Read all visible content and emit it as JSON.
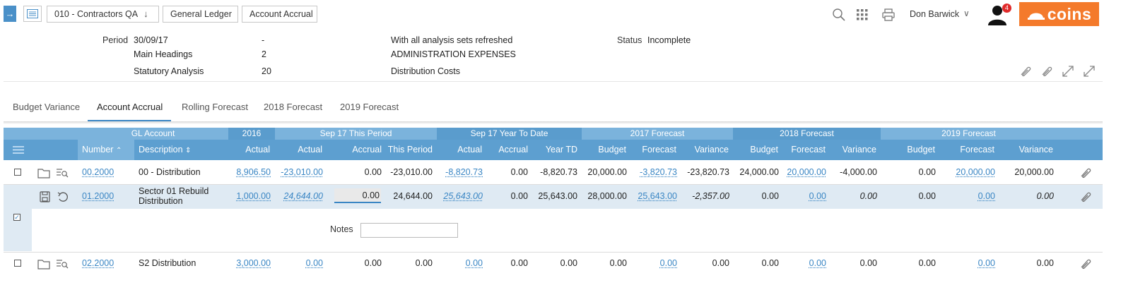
{
  "breadcrumb": {
    "items": [
      "010 - Contractors QA",
      "General Ledger",
      "Account Accrual"
    ]
  },
  "user": {
    "name": "Don Barwick",
    "notifications": "4"
  },
  "logo": {
    "text": "coins",
    "color": "#f47a2b"
  },
  "info": {
    "period_label": "Period",
    "period_value": "30/09/17",
    "period_dash": "-",
    "refresh_note": "With all analysis sets refreshed",
    "status_label": "Status",
    "status_value": "Incomplete",
    "main_headings_label": "Main Headings",
    "main_headings_value": "2",
    "main_headings_desc": "ADMINISTRATION EXPENSES",
    "statutory_label": "Statutory Analysis",
    "statutory_value": "20",
    "statutory_desc": "Distribution Costs"
  },
  "tabs": [
    "Budget Variance",
    "Account Accrual",
    "Rolling Forecast",
    "2018 Forecast",
    "2019 Forecast"
  ],
  "active_tab": "Account Accrual",
  "grid": {
    "groups": [
      "GL Account",
      "2016",
      "Sep 17 This Period",
      "Sep 17 Year To Date",
      "2017 Forecast",
      "2018 Forecast",
      "2019 Forecast"
    ],
    "columns": [
      "Number",
      "Description",
      "Actual",
      "Actual",
      "Accrual",
      "This Period",
      "Actual",
      "Accrual",
      "Year TD",
      "Budget",
      "Forecast",
      "Variance",
      "Budget",
      "Forecast",
      "Variance",
      "Budget",
      "Forecast",
      "Variance"
    ],
    "rows": [
      {
        "number": "00.2000",
        "description": "00 - Distribution",
        "a2016": "8,906.50",
        "tp_actual": "-23,010.00",
        "tp_accrual": "0.00",
        "tp_period": "-23,010.00",
        "ytd_actual": "-8,820.73",
        "ytd_accrual": "0.00",
        "ytd_total": "-8,820.73",
        "f17_budget": "20,000.00",
        "f17_forecast": "-3,820.73",
        "f17_variance": "-23,820.73",
        "f18_budget": "24,000.00",
        "f18_forecast": "20,000.00",
        "f18_variance": "-4,000.00",
        "f19_budget": "0.00",
        "f19_forecast": "20,000.00",
        "f19_variance": "20,000.00"
      },
      {
        "number": "01.2000",
        "description_line1": "Sector 01 Rebuild",
        "description_line2": "Distribution",
        "a2016": "1,000.00",
        "tp_actual": "24,644.00",
        "tp_accrual": "0.00",
        "tp_period": "24,644.00",
        "ytd_actual": "25,643.00",
        "ytd_accrual": "0.00",
        "ytd_total": "25,643.00",
        "f17_budget": "28,000.00",
        "f17_forecast": "25,643.00",
        "f17_variance": "-2,357.00",
        "f18_budget": "0.00",
        "f18_forecast": "0.00",
        "f18_variance": "0.00",
        "f19_budget": "0.00",
        "f19_forecast": "0.00",
        "f19_variance": "0.00"
      },
      {
        "number": "02.2000",
        "description": "S2 Distribution",
        "a2016": "3,000.00",
        "tp_actual": "0.00",
        "tp_accrual": "0.00",
        "tp_period": "0.00",
        "ytd_actual": "0.00",
        "ytd_accrual": "0.00",
        "ytd_total": "0.00",
        "f17_budget": "0.00",
        "f17_forecast": "0.00",
        "f17_variance": "0.00",
        "f18_budget": "0.00",
        "f18_forecast": "0.00",
        "f18_variance": "0.00",
        "f19_budget": "0.00",
        "f19_forecast": "0.00",
        "f19_variance": "0.00"
      }
    ],
    "notes_label": "Notes",
    "colors": {
      "header_light": "#7bb3dc",
      "header_dark": "#5d9fd0",
      "link": "#3a86c4",
      "selected_row": "#dfeaf3"
    }
  }
}
